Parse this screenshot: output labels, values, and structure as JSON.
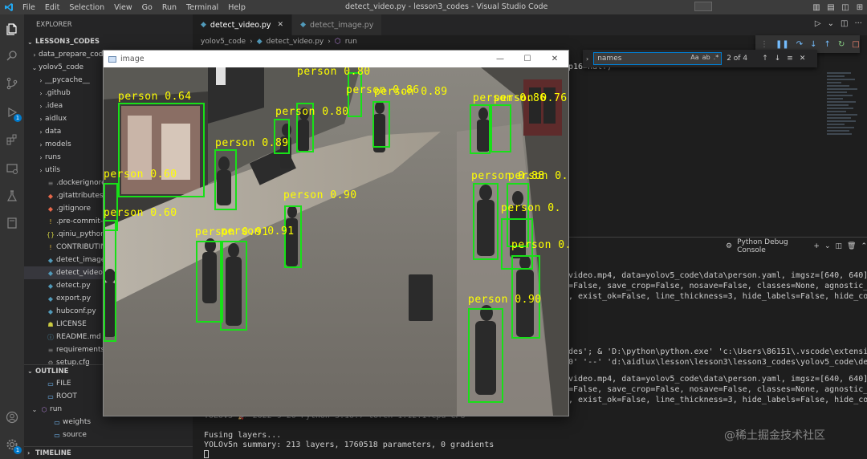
{
  "app": {
    "menus": [
      "File",
      "Edit",
      "Selection",
      "View",
      "Go",
      "Run",
      "Terminal",
      "Help"
    ],
    "window_title": "detect_video.py - lesson3_codes - Visual Studio Code",
    "accent": "#007acc"
  },
  "activitybar": {
    "run_badge": "1",
    "accounts_badge": "1"
  },
  "explorer": {
    "title": "EXPLORER",
    "section": "LESSON3_CODES",
    "items": [
      {
        "label": "data_prepare_code",
        "type": "folder",
        "expanded": false,
        "indent": 1
      },
      {
        "label": "yolov5_code",
        "type": "folder",
        "expanded": true,
        "indent": 1
      },
      {
        "label": "__pycache__",
        "type": "folder",
        "expanded": false,
        "indent": 2
      },
      {
        "label": ".github",
        "type": "folder",
        "expanded": false,
        "indent": 2
      },
      {
        "label": ".idea",
        "type": "folder",
        "expanded": false,
        "indent": 2
      },
      {
        "label": "aidlux",
        "type": "folder",
        "expanded": false,
        "indent": 2
      },
      {
        "label": "data",
        "type": "folder",
        "expanded": false,
        "indent": 2
      },
      {
        "label": "models",
        "type": "folder",
        "expanded": false,
        "indent": 2
      },
      {
        "label": "runs",
        "type": "folder",
        "expanded": false,
        "indent": 2
      },
      {
        "label": "utils",
        "type": "folder",
        "expanded": false,
        "indent": 2
      },
      {
        "label": ".dockerignore",
        "type": "file",
        "icon": "≡",
        "indent": 2
      },
      {
        "label": ".gitattributes",
        "type": "file",
        "icon": "◆",
        "indent": 2
      },
      {
        "label": ".gitignore",
        "type": "file",
        "icon": "◆",
        "indent": 2
      },
      {
        "label": ".pre-commit-config.yaml",
        "type": "file",
        "icon": "!",
        "indent": 2
      },
      {
        "label": ".qiniu_pythonsdk_hostscache.json",
        "type": "file",
        "icon": "{}",
        "indent": 2
      },
      {
        "label": "CONTRIBUTING.md",
        "type": "file",
        "icon": "!",
        "indent": 2
      },
      {
        "label": "detect_image.py",
        "type": "file",
        "icon": "py",
        "indent": 2
      },
      {
        "label": "detect_video.py",
        "type": "file",
        "icon": "py",
        "indent": 2,
        "selected": true
      },
      {
        "label": "detect.py",
        "type": "file",
        "icon": "py",
        "indent": 2
      },
      {
        "label": "export.py",
        "type": "file",
        "icon": "py",
        "indent": 2
      },
      {
        "label": "hubconf.py",
        "type": "file",
        "icon": "py",
        "indent": 2
      },
      {
        "label": "LICENSE",
        "type": "file",
        "icon": "lic",
        "indent": 2
      },
      {
        "label": "README.md",
        "type": "file",
        "icon": "md",
        "indent": 2
      },
      {
        "label": "requirements.txt",
        "type": "file",
        "icon": "≡",
        "indent": 2
      },
      {
        "label": "setup.cfg",
        "type": "file",
        "icon": "⚙",
        "indent": 2
      }
    ]
  },
  "outline": {
    "title": "OUTLINE",
    "items": [
      {
        "label": "FILE",
        "indent": 1
      },
      {
        "label": "ROOT",
        "indent": 1
      },
      {
        "label": "run",
        "indent": 0,
        "expanded": true
      },
      {
        "label": "weights",
        "indent": 2
      },
      {
        "label": "source",
        "indent": 2
      }
    ]
  },
  "timeline": {
    "title": "TIMELINE"
  },
  "editor": {
    "tabs": [
      {
        "label": "detect_video.py",
        "active": true
      },
      {
        "label": "detect_image.py",
        "active": false
      }
    ],
    "breadcrumb": [
      "yolov5_code",
      "detect_video.py",
      "run"
    ],
    "code_fragment": "p16=half)"
  },
  "find_widget": {
    "query": "names",
    "options": [
      "Aa",
      "ab",
      ".*"
    ],
    "count": "2 of 4"
  },
  "panel": {
    "dropdown_label": "Python Debug Console",
    "lines_1": [
      "video.mp4, data=yolov5_code\\data\\person.yaml, imgsz=[640, 640], conf_th",
      "=False, save_crop=False, nosave=False, classes=None, agnostic_nms=False",
      ", exist_ok=False, line_thickness=3, hide_labels=False, hide_conf=False,"
    ],
    "lines_2": [
      "des'; & 'D:\\python\\python.exe' 'c:\\Users\\86151\\.vscode\\extensions\\ms-py",
      "0' '--' 'd:\\aidlux\\lesson\\lesson3\\lesson3_codes\\yolov5_code\\detect_vide"
    ],
    "lines_3": [
      "video.mp4, data=yolov5_code\\data\\person.yaml, imgsz=[640, 640], conf_th",
      "=False, save_crop=False, nosave=False, classes=None, agnostic_nms=False",
      ", exist_ok=False, line_thickness=3, hide_labels=False, hide_conf=False,"
    ],
    "version_line": "YOLOv5 🚀 2022-9-20 Python-3.10.7 torch-1.12.1+cpu CPU",
    "fusing_line": "Fusing layers...",
    "summary_line": "YOLOv5n summary: 213 layers, 1760518 parameters, 0 gradients"
  },
  "image_window": {
    "title": "image",
    "detections": [
      {
        "label": "person 0.64"
      },
      {
        "label": "person 0.80"
      },
      {
        "label": "person 0.86"
      },
      {
        "label": "person 0.80"
      },
      {
        "label": "person 0.89"
      },
      {
        "label": "person 0.89"
      },
      {
        "label": "person 0.60"
      },
      {
        "label": "person 0.60"
      },
      {
        "label": "person 0.90"
      },
      {
        "label": "person 0.91"
      },
      {
        "label": "person 0.91"
      },
      {
        "label": "person 0.86"
      },
      {
        "label": "person 0.76"
      },
      {
        "label": "person 0.88"
      },
      {
        "label": "person 0.8"
      },
      {
        "label": "person 0."
      },
      {
        "label": "person 0."
      },
      {
        "label": "person 0.90"
      }
    ]
  },
  "watermark": "@稀土掘金技术社区"
}
